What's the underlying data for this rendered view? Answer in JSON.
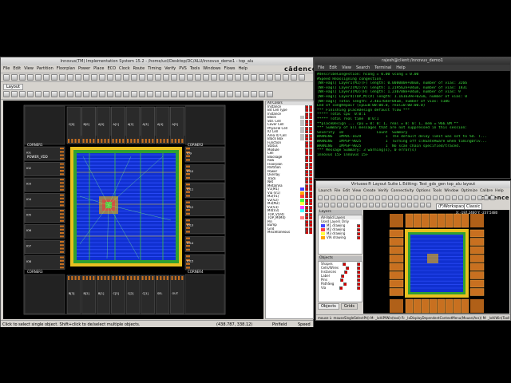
{
  "innovus": {
    "title": "Innovus(TM) Implementation System 15.2 - /home/ucl/Desktop/DC/ALU/innovus_demo1 - top_alu",
    "menus": [
      "File",
      "Edit",
      "View",
      "Partition",
      "Floorplan",
      "Power",
      "Place",
      "ECO",
      "Clock",
      "Route",
      "Timing",
      "Verify",
      "PVS",
      "Tools",
      "Windows",
      "Flows",
      "Help"
    ],
    "brand": "cādence",
    "tab": "Layout",
    "pin_labels": {
      "top": [
        "C[0]",
        "B[0]",
        "A[0]",
        "A[1]",
        "A[2]",
        "A[3]",
        "A[4]",
        "A[5]"
      ],
      "bottom": [
        "B[3]",
        "B[2]",
        "B[1]",
        "C[3]",
        "C[2]",
        "C[1]",
        "SEL",
        "OUT"
      ],
      "left": [
        "CORNER1",
        "POWER_VDD",
        "IO1",
        "IO2",
        "IO3",
        "IO4",
        "IO5",
        "IO6",
        "IO7",
        "IO8",
        "CORNER3"
      ],
      "right": [
        "CORNER2",
        "IO9",
        "IO10",
        "IO11",
        "IO12",
        "IO13",
        "IO14",
        "IO15",
        "CORNER4"
      ]
    },
    "layer_panel": {
      "header": "All Colors",
      "items": [
        {
          "label": "Instance",
          "color": "#ffffff"
        },
        {
          "label": "Bit Cell Type",
          "color": "#ffffff"
        },
        {
          "label": "Instance",
          "color": "#ffffff"
        },
        {
          "label": "Block",
          "color": "#c0c0c0"
        },
        {
          "label": "Std. Cell",
          "color": "#c0c0c0"
        },
        {
          "label": "Cover Cell",
          "color": "#c0c0c0"
        },
        {
          "label": "Physical Cell",
          "color": "#c0c0c0"
        },
        {
          "label": "IO Cell",
          "color": "#c0c0c0"
        },
        {
          "label": "Area IO Cell",
          "color": "#c0c0c0"
        },
        {
          "label": "Black Box",
          "color": "#c0c0c0"
        },
        {
          "label": "Function",
          "color": "#ffffff"
        },
        {
          "label": "Status",
          "color": "#ffffff"
        },
        {
          "label": "Module",
          "color": "#ffffff"
        },
        {
          "label": "Cell",
          "color": "#ffffff"
        },
        {
          "label": "Blockage",
          "color": "#ffffff"
        },
        {
          "label": "Row",
          "color": "#ffffff"
        },
        {
          "label": "Floorplan",
          "color": "#ffffff"
        },
        {
          "label": "Partition",
          "color": "#ffffff"
        },
        {
          "label": "Power",
          "color": "#ffffff"
        },
        {
          "label": "Overlay",
          "color": "#ffffff"
        },
        {
          "label": "Track",
          "color": "#ffffff"
        },
        {
          "label": "Net",
          "color": "#ffffff"
        },
        {
          "label": "Metal/Via",
          "color": "#ffffff"
        },
        {
          "label": "V1(M1)",
          "color": "#4040ff"
        },
        {
          "label": "Via (V1)",
          "color": "#ffa500"
        },
        {
          "label": "M2(V1)",
          "color": "#ff4040"
        },
        {
          "label": "V2(V2)",
          "color": "#40ff40"
        },
        {
          "label": "M3(M2)",
          "color": "#ffff40"
        },
        {
          "label": "V3(V3)",
          "color": "#ff40ff"
        },
        {
          "label": "M4(V3)",
          "color": "#40ffff"
        },
        {
          "label": "TOP_V(V4)",
          "color": "#ffffff"
        },
        {
          "label": "TOP_M(M4)",
          "color": "#ff8080"
        },
        {
          "label": "Pin",
          "color": "#ffffff"
        },
        {
          "label": "Bump",
          "color": "#ffffff"
        },
        {
          "label": "Grid",
          "color": "#ffffff"
        },
        {
          "label": "Miscellaneous",
          "color": "#ffffff"
        }
      ]
    },
    "status_left": "Click to select single object. Shift+click to de/select multiple objects.",
    "status_coords": "(438.787, 338.12)",
    "status_mode": "Pinfield",
    "status_speed": "Speed"
  },
  "terminal": {
    "title": "rajesh@client:/innovus_demo1",
    "menus": [
      "File",
      "Edit",
      "View",
      "Search",
      "Terminal",
      "Help"
    ],
    "lines": [
      "#describeCongestion: hcong = 0.00 vcong = 0.00",
      "#Speed Reassigning congestion.",
      "[NR-eagl] Layer1(M1)(F) length: 0.000000e+00um, number of vias: 3266",
      "[NR-eagl] Layer2(M2)(V) length: 1.219562e+04um, number of vias: 1831",
      "[NR-eagl] Layer3(M3)(H) length: 1.230788e+04um, number of vias: 9",
      "[NR-eagl] Layer4(TOP_M)(V) length: 1.161639e+02um, number of vias: 0",
      "[NR-eagl] Total length: 2.461764e+04um, number of vias: 5106",
      "End of congRepair (cpu=0:00:00.0, real=0:00:00.0)",
      "*** Finishing placeDesign default flow ***",
      "***** Total cpu  0:0:1",
      "***** Total real time  0:0:1",
      "**placeDesign ... cpu = 0: 0: 1, real = 0: 0: 1, mem = 966.0M **",
      "",
      "*** Summary of all messages that are not suppressed in this session:",
      "Severity  ID               Count  Summary",
      "WARNING   IMPDC-1629           1  The default delay limit was set to %d. T...",
      "WARNING   IMPSP-9025           1  Turning off clkGateAware when timingDriv...",
      "WARNING   IMPSP-9025           1  No scan chain specified/traced.",
      "*** Message Summary: 3 warning(s), 0 error(s)",
      "",
      "innovus 15> innovus 15> "
    ]
  },
  "virtuoso": {
    "title": "Virtuoso® Layout Suite L Editing: Test_gds_gen top_alu layout",
    "menus": [
      "Launch",
      "File",
      "Edit",
      "View",
      "Create",
      "Verify",
      "Connectivity",
      "Options",
      "Tools",
      "Window",
      "Optimize",
      "Calibre",
      "Help"
    ],
    "brand": "cādence",
    "toolbar_field": "(F)Workspace",
    "toolbar_value": "Classic",
    "layers_title": "Layers",
    "layer_filter": "AV-Valid Layers",
    "layer_mode": "Used Layers Only",
    "layer_items": [
      {
        "label": "M1  drawing",
        "color": "#4040ff"
      },
      {
        "label": "M2  drawing",
        "color": "#ff4040"
      },
      {
        "label": "M3  drawing",
        "color": "#ffff40"
      },
      {
        "label": "VIA  drawing",
        "color": "#ffa500"
      }
    ],
    "objects_title": "Objects",
    "object_items": [
      "Shapes",
      "Cells/Wires",
      "Instances",
      "Label",
      "Pins",
      "PathSeg",
      "Via"
    ],
    "pane_tabs": [
      "Objects",
      "Grids"
    ],
    "coord": "X: -197.2460  Y: -237.5480",
    "status_left": "mouse L: mouseSingleSelectPt()  M: _lxHiPfWin(tool)  R: _lxDisplayDependentContextMenu(Mouse(Acs))  M: _lxHiWin(ToolPos()) sB"
  }
}
